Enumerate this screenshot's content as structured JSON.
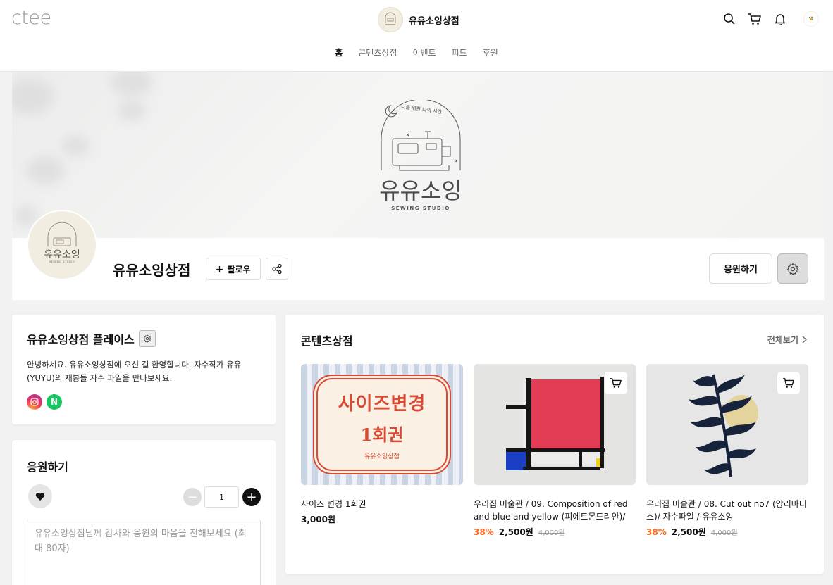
{
  "header": {
    "logo": "ctee",
    "shop_name": "유유소잉상점",
    "icons": [
      "search-icon",
      "cart-icon",
      "bell-icon",
      "user-avatar"
    ],
    "nav": [
      {
        "label": "홈",
        "active": true
      },
      {
        "label": "콘텐츠상점",
        "active": false
      },
      {
        "label": "이벤트",
        "active": false
      },
      {
        "label": "피드",
        "active": false
      },
      {
        "label": "후원",
        "active": false
      }
    ]
  },
  "banner": {
    "arc_text": "너를 위한 나의 시간",
    "brand": "유유소잉",
    "sub": "SEWING STUDIO"
  },
  "profile": {
    "name": "유유소잉상점",
    "follow_label": "팔로우",
    "support_label": "응원하기"
  },
  "place": {
    "title": "유유소잉상점 플레이스",
    "description": "안녕하세요. 유유소잉상점에 오신 걸 환영합니다. 자수작가 유유(YUYU)의 재봉들 자수 파일을 만나보세요.",
    "sns": [
      "instagram-icon",
      "naver-icon"
    ],
    "naver_letter": "N"
  },
  "support": {
    "title": "응원하기",
    "quantity": "1",
    "minus": "−",
    "plus": "+",
    "message_placeholder": "유유소잉상점님께 감사와 응원의 마음을 전해보세요 (최대 80자)"
  },
  "store": {
    "title": "콘텐츠상점",
    "view_all": "전체보기",
    "products": [
      {
        "title": "사이즈 변경 1회권",
        "price": "3,000원",
        "thumb_line1": "사이즈변경",
        "thumb_line2": "1회권",
        "thumb_line3": "유유소잉상점"
      },
      {
        "title": "우리집 미술관 / 09. Composition of red and blue and yellow (피에트몬드리안)/ …",
        "discount": "38%",
        "price": "2,500원",
        "original": "4,000원"
      },
      {
        "title": "우리집 미술관 / 08. Cut out no7 (앙리마티스)/ 자수파일 / 유유소잉",
        "discount": "38%",
        "price": "2,500원",
        "original": "4,000원"
      }
    ]
  }
}
